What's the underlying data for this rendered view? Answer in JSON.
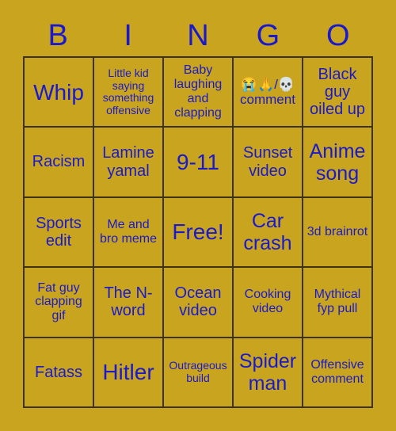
{
  "card": {
    "title": "BINGO",
    "background_color": "#c9a41f",
    "text_color": "#1a1acc",
    "border_color": "#3d3212"
  },
  "header": {
    "letters": [
      "B",
      "I",
      "N",
      "G",
      "O"
    ]
  },
  "grid": {
    "rows": 5,
    "columns": 5,
    "cells": [
      {
        "text": "Whip",
        "size": "s-xl"
      },
      {
        "text": "Little kid saying something offensive",
        "size": "s-xs"
      },
      {
        "text": "Baby laughing and clapping",
        "size": "s-sm"
      },
      {
        "text": "😭🙏/💀 comment",
        "size": "s-emoji"
      },
      {
        "text": "Black guy oiled up",
        "size": "s-md"
      },
      {
        "text": "Racism",
        "size": "s-md"
      },
      {
        "text": "Lamine yamal",
        "size": "s-md"
      },
      {
        "text": "9-11",
        "size": "s-xl"
      },
      {
        "text": "Sunset video",
        "size": "s-md"
      },
      {
        "text": "Anime song",
        "size": "s-lg"
      },
      {
        "text": "Sports edit",
        "size": "s-md"
      },
      {
        "text": "Me and bro meme",
        "size": "s-sm"
      },
      {
        "text": "Free!",
        "size": "s-xl"
      },
      {
        "text": "Car crash",
        "size": "s-lg"
      },
      {
        "text": "3d brainrot",
        "size": "s-sm"
      },
      {
        "text": "Fat guy clapping gif",
        "size": "s-sm"
      },
      {
        "text": "The N-word",
        "size": "s-md"
      },
      {
        "text": "Ocean video",
        "size": "s-md"
      },
      {
        "text": "Cooking video",
        "size": "s-sm"
      },
      {
        "text": "Mythical fyp pull",
        "size": "s-sm"
      },
      {
        "text": "Fatass",
        "size": "s-md"
      },
      {
        "text": "Hitler",
        "size": "s-xl"
      },
      {
        "text": "Outrageous build",
        "size": "s-xs"
      },
      {
        "text": "Spider man",
        "size": "s-lg"
      },
      {
        "text": "Offensive comment",
        "size": "s-sm"
      }
    ]
  }
}
